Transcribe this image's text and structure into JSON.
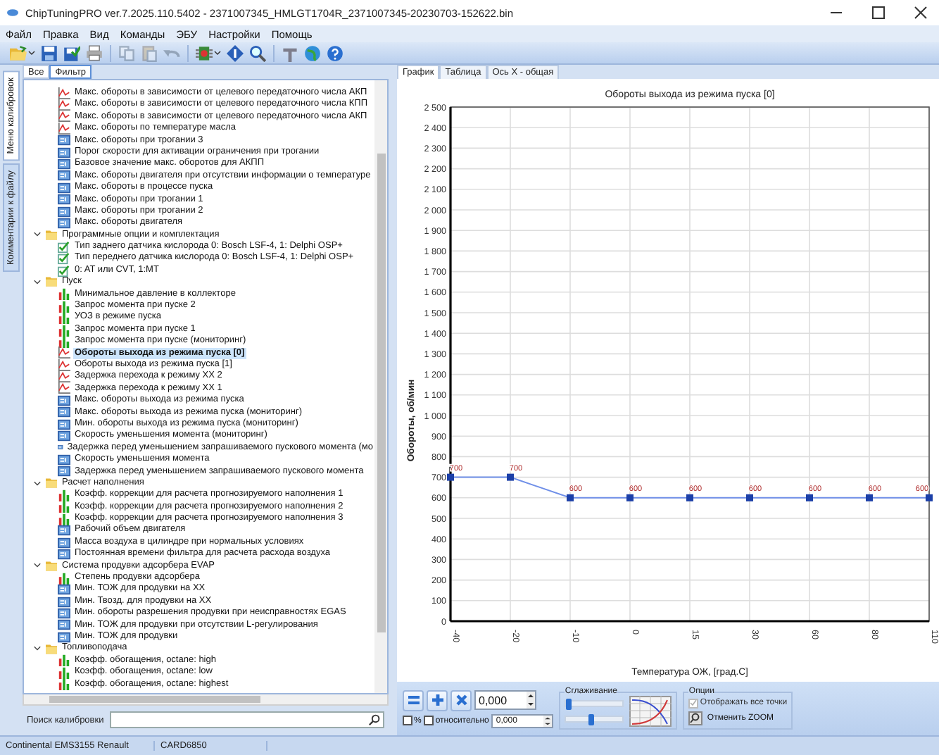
{
  "window": {
    "title": "ChipTuningPRO ver.7.2025.110.5402 - 2371007345_HMLGT1704R_2371007345-20230703-152622.bin"
  },
  "menu": [
    "Файл",
    "Правка",
    "Вид",
    "Команды",
    "ЭБУ",
    "Настройки",
    "Помощь"
  ],
  "toolbar": [
    {
      "kind": "open",
      "disabled": false,
      "dropdown": true
    },
    {
      "kind": "save",
      "disabled": false,
      "dropdown": false
    },
    {
      "kind": "save-check",
      "disabled": false,
      "dropdown": false
    },
    {
      "kind": "print",
      "disabled": false,
      "dropdown": false
    },
    {
      "kind": "copy",
      "disabled": true,
      "dropdown": false
    },
    {
      "kind": "paste",
      "disabled": true,
      "dropdown": false
    },
    {
      "kind": "undo",
      "disabled": true,
      "dropdown": false
    },
    {
      "kind": "chip",
      "disabled": false,
      "dropdown": true
    },
    {
      "kind": "diamond",
      "disabled": false,
      "dropdown": false
    },
    {
      "kind": "zoom",
      "disabled": false,
      "dropdown": false
    },
    {
      "kind": "tool",
      "disabled": false,
      "dropdown": false
    },
    {
      "kind": "globe",
      "disabled": false,
      "dropdown": false
    },
    {
      "kind": "help",
      "disabled": false,
      "dropdown": false
    }
  ],
  "side_tabs": [
    {
      "label": "Меню калибровок",
      "selected": true
    },
    {
      "label": "Комментарии к файлу",
      "selected": false
    }
  ],
  "left_tabs": [
    {
      "label": "Все",
      "selected": false
    },
    {
      "label": "Фильтр",
      "selected": true
    }
  ],
  "tree": [
    {
      "expanded": true,
      "children": [
        {
          "kind": "curve",
          "label": "Макс. обороты  в зависимости от целевого передаточного числа АКП",
          "selected": false
        },
        {
          "kind": "curve",
          "label": "Макс. обороты  в зависимости от целевого передаточного числа КПП",
          "selected": false
        },
        {
          "kind": "curve",
          "label": "Макс. обороты  в зависимости от целевого передаточного числа АКП",
          "selected": false
        },
        {
          "kind": "curve",
          "label": "Макс. обороты по температуре масла",
          "selected": false
        },
        {
          "kind": "value",
          "label": "Макс. обороты при трогании 3",
          "selected": false
        },
        {
          "kind": "value",
          "label": "Порог скорости для активации ограничения при трогании",
          "selected": false
        },
        {
          "kind": "value",
          "label": "Базовое значение макс. оборотов для АКПП",
          "selected": false
        },
        {
          "kind": "value",
          "label": "Макс. обороты двигателя при отсутствии  информации о температуре",
          "selected": false
        },
        {
          "kind": "value",
          "label": "Макс. обороты в процессе пуска",
          "selected": false
        },
        {
          "kind": "value",
          "label": "Макс. обороты при трогании 1",
          "selected": false
        },
        {
          "kind": "value",
          "label": "Макс. обороты при трогании 2",
          "selected": false
        },
        {
          "kind": "value",
          "label": "Макс. обороты двигателя",
          "selected": false
        }
      ]
    },
    {
      "label": "Программные опции и комплектация",
      "expanded": true,
      "children": [
        {
          "kind": "flag",
          "label": "Тип заднего датчика кислорода 0: Bosch LSF-4, 1: Delphi OSP+",
          "selected": false
        },
        {
          "kind": "flag",
          "label": "Тип переднего датчика кислорода 0: Bosch LSF-4, 1: Delphi OSP+",
          "selected": false
        },
        {
          "kind": "flag",
          "label": "0: AT или CVT, 1:MT",
          "selected": false
        }
      ]
    },
    {
      "label": "Пуск",
      "expanded": true,
      "children": [
        {
          "kind": "surface",
          "label": "Минимальное давление в коллекторе",
          "selected": false
        },
        {
          "kind": "surface",
          "label": "Запрос момента при пуске 2",
          "selected": false
        },
        {
          "kind": "surface",
          "label": "УОЗ в режиме пуска",
          "selected": false
        },
        {
          "kind": "surface",
          "label": "Запрос момента при пуске 1",
          "selected": false
        },
        {
          "kind": "surface",
          "label": "Запрос момента при пуске (мониторинг)",
          "selected": false
        },
        {
          "kind": "curve",
          "label": "Обороты выхода из режима пуска [0]",
          "selected": true
        },
        {
          "kind": "curve",
          "label": "Обороты выхода из режима пуска [1]",
          "selected": false
        },
        {
          "kind": "curve",
          "label": "Задержка перехода к режиму ХХ 2",
          "selected": false
        },
        {
          "kind": "curve",
          "label": "Задержка перехода к режиму ХХ 1",
          "selected": false
        },
        {
          "kind": "value",
          "label": "Макс. обороты выхода из режима пуска",
          "selected": false
        },
        {
          "kind": "value",
          "label": "Макс. обороты выхода из режима пуска (мониторинг)",
          "selected": false
        },
        {
          "kind": "value",
          "label": "Мин. обороты выхода из режима пуска (мониторинг)",
          "selected": false
        },
        {
          "kind": "value",
          "label": "Скорость уменьшения момента (мониторинг)",
          "selected": false
        },
        {
          "kind": "value",
          "label": "Задержка перед уменьшением запрашиваемого пускового момента (мо",
          "selected": false
        },
        {
          "kind": "value",
          "label": "Скорость уменьшения момента",
          "selected": false
        },
        {
          "kind": "value",
          "label": "Задержка перед уменьшением запрашиваемого пускового момента",
          "selected": false
        }
      ]
    },
    {
      "label": "Расчет наполнения",
      "expanded": true,
      "children": [
        {
          "kind": "surface",
          "label": "Коэфф. коррекции для расчета прогнозируемого наполнения 1",
          "selected": false
        },
        {
          "kind": "surface",
          "label": "Коэфф. коррекции для расчета прогнозируемого наполнения 2",
          "selected": false
        },
        {
          "kind": "surface",
          "label": "Коэфф. коррекции для расчета прогнозируемого наполнения 3",
          "selected": false
        },
        {
          "kind": "value",
          "label": "Рабочий объем двигателя",
          "selected": false
        },
        {
          "kind": "value",
          "label": "Масса воздуха в цилиндре при нормальных условиях",
          "selected": false
        },
        {
          "kind": "value",
          "label": "Постоянная времени фильтра для расчета расхода воздуха",
          "selected": false
        }
      ]
    },
    {
      "label": "Система продувки адсорбера EVAP",
      "expanded": true,
      "children": [
        {
          "kind": "surface",
          "label": "Степень продувки адсорбера",
          "selected": false
        },
        {
          "kind": "value",
          "label": "Мин. ТОЖ для продувки на ХХ",
          "selected": false
        },
        {
          "kind": "value",
          "label": "Мин. Твозд. для продувки на ХХ",
          "selected": false
        },
        {
          "kind": "value",
          "label": "Мин. обороты разрешения продувки при неисправностях EGAS",
          "selected": false
        },
        {
          "kind": "value",
          "label": "Мин. ТОЖ для продувки при отсутствии L-регулирования",
          "selected": false
        },
        {
          "kind": "value",
          "label": "Мин. ТОЖ для продувки",
          "selected": false
        }
      ]
    },
    {
      "label": "Топливоподача",
      "expanded": true,
      "children": [
        {
          "kind": "surface",
          "label": "Коэфф. обогащения, octane: high",
          "selected": false
        },
        {
          "kind": "surface",
          "label": "Коэфф. обогащения, octane: low",
          "selected": false
        },
        {
          "kind": "surface",
          "label": "Коэфф. обогащения, octane: highest",
          "selected": false
        }
      ]
    }
  ],
  "search": {
    "label": "Поиск калибровки"
  },
  "right_tabs": [
    {
      "label": "График",
      "selected": true
    },
    {
      "label": "Таблица",
      "selected": false
    },
    {
      "label": "Ось X - общая",
      "selected": false
    }
  ],
  "chart": {
    "chart_data": {
      "type": "line",
      "title": "Обороты выхода из режима пуска [0]",
      "xlabel": "Температура ОЖ, [град.С]",
      "ylabel": "Обороты, об/мин",
      "categories": [
        "-40",
        "-20",
        "-10",
        "0",
        "15",
        "30",
        "60",
        "80",
        "110"
      ],
      "series": [
        {
          "color": "#6f8fe8",
          "marker": "square",
          "values": [
            700,
            700,
            600,
            600,
            600,
            600,
            600,
            600,
            600
          ]
        }
      ],
      "grid": true,
      "ylim": [
        0,
        2500
      ],
      "yticks": [
        {
          "value": 0,
          "label": "0"
        },
        {
          "value": 100,
          "label": "100"
        },
        {
          "value": 200,
          "label": "200"
        },
        {
          "value": 300,
          "label": "300"
        },
        {
          "value": 400,
          "label": "400"
        },
        {
          "value": 500,
          "label": "500"
        },
        {
          "value": 600,
          "label": "600"
        },
        {
          "value": 700,
          "label": "700"
        },
        {
          "value": 800,
          "label": "800"
        },
        {
          "value": 900,
          "label": "900"
        },
        {
          "value": 1000,
          "label": "1 000"
        },
        {
          "value": 1100,
          "label": "1 100"
        },
        {
          "value": 1200,
          "label": "1 200"
        },
        {
          "value": 1300,
          "label": "1 300"
        },
        {
          "value": 1400,
          "label": "1 400"
        },
        {
          "value": 1500,
          "label": "1 500"
        },
        {
          "value": 1600,
          "label": "1 600"
        },
        {
          "value": 1700,
          "label": "1 700"
        },
        {
          "value": 1800,
          "label": "1 800"
        },
        {
          "value": 1900,
          "label": "1 900"
        },
        {
          "value": 2000,
          "label": "2 000"
        },
        {
          "value": 2100,
          "label": "2 100"
        },
        {
          "value": 2200,
          "label": "2 200"
        },
        {
          "value": 2300,
          "label": "2 300"
        },
        {
          "value": 2400,
          "label": "2 400"
        },
        {
          "value": 2500,
          "label": "2 500"
        }
      ],
      "data_labels": true
    }
  },
  "controls": {
    "value": "0,000",
    "percent": {
      "label": "%",
      "checked": false
    },
    "relative": {
      "label": "относительно",
      "checked": false
    },
    "relative_value": "0,000",
    "smoothing": {
      "title": "Сглаживание",
      "sliders": [
        {
          "level": 0.03
        },
        {
          "level": 0.45
        }
      ]
    },
    "options": {
      "title": "Опции",
      "show_all_points": {
        "label": "Отображать все точки",
        "checked": true,
        "disabled": true
      },
      "reset_zoom": "Отменить ZOOM"
    }
  },
  "status_bar": [
    "Continental EMS3155 Renault",
    "CARD6850"
  ]
}
